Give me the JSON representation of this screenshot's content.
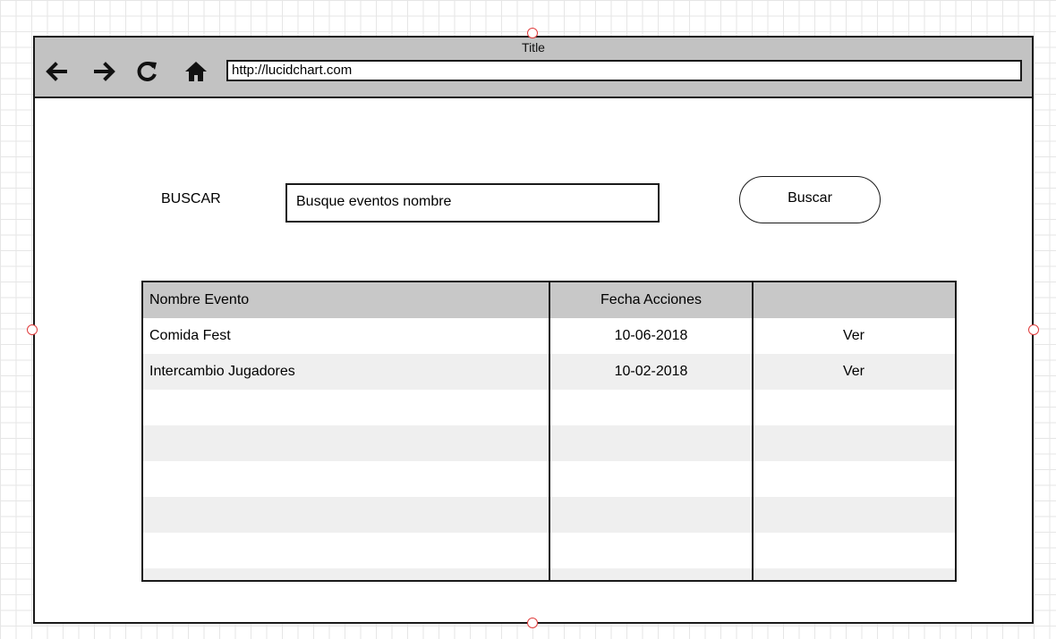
{
  "window": {
    "title": "Title",
    "url": "http://lucidchart.com"
  },
  "nav_icons": [
    "arrow-left-icon",
    "arrow-right-icon",
    "refresh-icon",
    "home-icon"
  ],
  "search": {
    "label": "BUSCAR",
    "input_value": "Busque eventos nombre",
    "button_label": "Buscar"
  },
  "table": {
    "headers": [
      "Nombre Evento",
      "Fecha Acciones",
      ""
    ],
    "rows": [
      [
        "Comida Fest",
        "10-06-2018",
        "Ver"
      ],
      [
        "Intercambio Jugadores",
        "10-02-2018",
        "Ver"
      ],
      [
        "",
        "",
        ""
      ],
      [
        "",
        "",
        ""
      ],
      [
        "",
        "",
        ""
      ],
      [
        "",
        "",
        ""
      ],
      [
        "",
        "",
        ""
      ],
      [
        "",
        "",
        ""
      ]
    ]
  },
  "colors": {
    "titlebar": "#c2c2c2",
    "header_row": "#c8c8c8",
    "stripe_row": "#efefef",
    "selection_handle": "#e03c3c"
  }
}
